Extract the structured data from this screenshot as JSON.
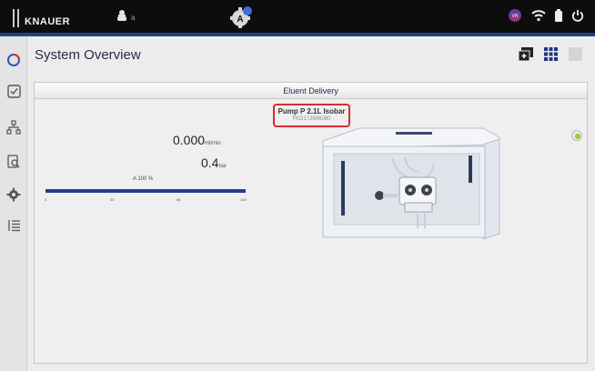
{
  "topbar": {
    "brand": "KNAUER",
    "user_label": "a"
  },
  "page": {
    "title": "System Overview"
  },
  "panel": {
    "header": "Eluent Delivery",
    "device_name": "Pump P 2.1L Isobar",
    "device_serial": "FKD172606080",
    "flow_value": "0.000",
    "flow_unit": "ml/min",
    "pressure_value": "0.4",
    "pressure_unit": "bar",
    "progress_label": "A 100 %",
    "progress_fraction": 1.0,
    "progress_ticks": [
      "0",
      "33",
      "66",
      "100"
    ]
  },
  "colors": {
    "accent": "#1f3f88",
    "highlight": "#d92b2b",
    "status_ok": "#9acd32"
  },
  "icons": {
    "sidebar": [
      "spinner-icon",
      "checklist-icon",
      "hierarchy-icon",
      "report-icon",
      "settings-icon",
      "list-icon"
    ],
    "top": [
      "user-icon",
      "gear-status-icon",
      "network-status-icon",
      "wifi-icon",
      "battery-icon",
      "power-icon"
    ]
  }
}
